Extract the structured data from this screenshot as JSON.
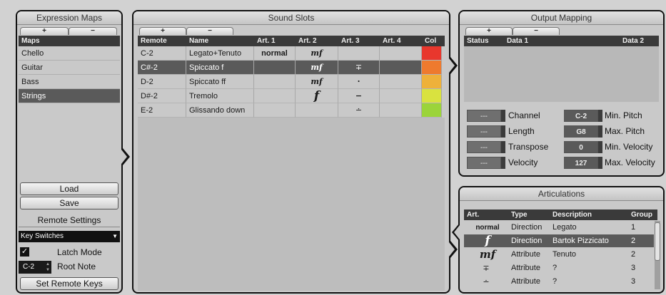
{
  "expression_maps": {
    "title": "Expression Maps",
    "add_label": "+",
    "remove_label": "−",
    "column_header": "Maps",
    "items": [
      {
        "label": "Chello"
      },
      {
        "label": "Guitar"
      },
      {
        "label": "Bass"
      },
      {
        "label": "Strings"
      }
    ],
    "selected_index": 3,
    "load_label": "Load",
    "save_label": "Save",
    "remote_settings_title": "Remote Settings",
    "remote_mode": "Key Switches",
    "latch_mode_label": "Latch Mode",
    "latch_mode_checked": true,
    "root_note_value": "C-2",
    "root_note_label": "Root Note",
    "set_remote_keys_label": "Set Remote Keys"
  },
  "sound_slots": {
    "title": "Sound Slots",
    "add_label": "+",
    "remove_label": "−",
    "columns": [
      "Remote",
      "Name",
      "Art. 1",
      "Art. 2",
      "Art. 3",
      "Art. 4",
      "Col"
    ],
    "rows": [
      {
        "remote": "C-2",
        "name": "Legato+Tenuto",
        "art1": "normal",
        "art2": "mf",
        "art3": "",
        "art4": "",
        "color": "#e8372d"
      },
      {
        "remote": "C#-2",
        "name": "Spiccato f",
        "art1": "",
        "art2": "mf",
        "art3": "∓",
        "art4": "",
        "color": "#ee7a2e"
      },
      {
        "remote": "D-2",
        "name": "Spiccato ff",
        "art1": "",
        "art2": "mf",
        "art3": "·",
        "art4": "",
        "color": "#eeb13a"
      },
      {
        "remote": "D#-2",
        "name": "Tremolo",
        "art1": "",
        "art2": "f",
        "art3": "−",
        "art4": "",
        "color": "#d9e23f"
      },
      {
        "remote": "E-2",
        "name": "Glissando down",
        "art1": "",
        "art2": "",
        "art3": "∸",
        "art4": "",
        "color": "#9bd43a"
      }
    ],
    "selected_index": 1
  },
  "output_mapping": {
    "title": "Output Mapping",
    "add_label": "+",
    "remove_label": "−",
    "columns": [
      "Status",
      "Data 1",
      "Data 2"
    ],
    "params_left": [
      {
        "value": "---",
        "label": "Channel"
      },
      {
        "value": "---",
        "label": "Length"
      },
      {
        "value": "---",
        "label": "Transpose"
      },
      {
        "value": "---",
        "label": "Velocity"
      }
    ],
    "params_right": [
      {
        "value": "C-2",
        "label": "Min. Pitch"
      },
      {
        "value": "G8",
        "label": "Max. Pitch"
      },
      {
        "value": "0",
        "label": "Min. Velocity"
      },
      {
        "value": "127",
        "label": "Max. Velocity"
      }
    ]
  },
  "articulations": {
    "title": "Articulations",
    "columns": [
      "Art.",
      "Type",
      "Description",
      "Group"
    ],
    "rows": [
      {
        "art": "normal",
        "type": "Direction",
        "description": "Legato",
        "group": "1"
      },
      {
        "art": "f",
        "type": "Direction",
        "description": "Bartok Pizzicato",
        "group": "2"
      },
      {
        "art": "mf",
        "type": "Attribute",
        "description": "Tenuto",
        "group": "2"
      },
      {
        "art": "∓",
        "type": "Attribute",
        "description": "?",
        "group": "3"
      },
      {
        "art": "∸",
        "type": "Attribute",
        "description": "?",
        "group": "3"
      }
    ],
    "selected_index": 1
  }
}
